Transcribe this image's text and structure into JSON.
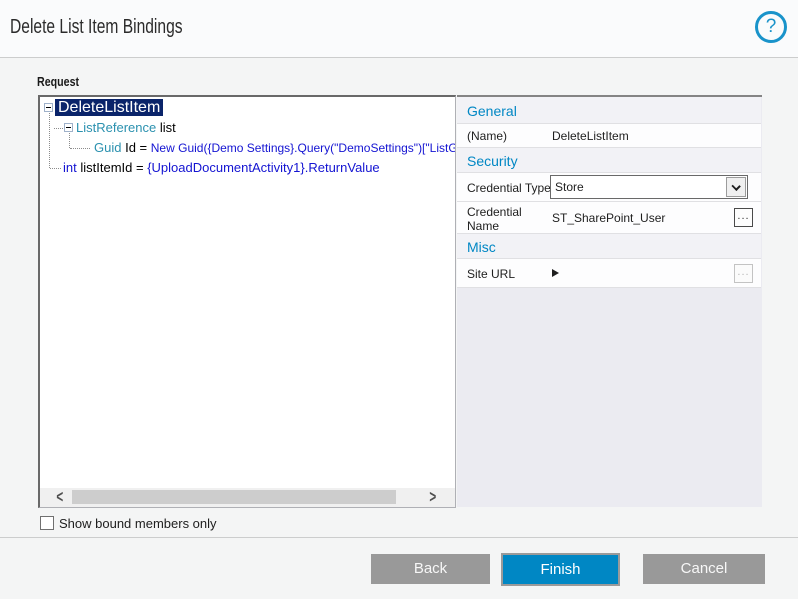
{
  "dialog": {
    "title": "Delete List Item Bindings",
    "help": "?"
  },
  "request": {
    "label": "Request",
    "tree": {
      "root": {
        "label": "DeleteListItem",
        "selected": true
      },
      "nodes": [
        {
          "type": "ListReference",
          "name": "list"
        },
        {
          "type": "Guid",
          "name": "Id",
          "eq": " = ",
          "value": "New Guid({Demo Settings}.Query(\"DemoSettings\")[\"ListG"
        },
        {
          "type": "int",
          "name": "listItemId",
          "eq": " = ",
          "value": "{UploadDocumentActivity1}.ReturnValue"
        }
      ]
    },
    "checkbox": {
      "label": "Show bound members only",
      "checked": false
    }
  },
  "properties": {
    "general_header": "General",
    "name_label": "(Name)",
    "name_value": "DeleteListItem",
    "security_header": "Security",
    "credential_type_label": "Credential Type",
    "credential_type_value": "Store",
    "credential_name_label_line1": "Credential",
    "credential_name_label_line2": "Name",
    "credential_name_value": "ST_SharePoint_User",
    "misc_header": "Misc",
    "site_url_label": "Site URL",
    "ellipsis_label": "..."
  },
  "buttons": {
    "back": "Back",
    "finish": "Finish",
    "cancel": "Cancel"
  },
  "colors": {
    "accent_blue": "#0087c4",
    "selection_navy": "#0a246a",
    "type_teal": "#2b91af",
    "value_blue": "#1414d2",
    "button_gray": "#999999"
  }
}
